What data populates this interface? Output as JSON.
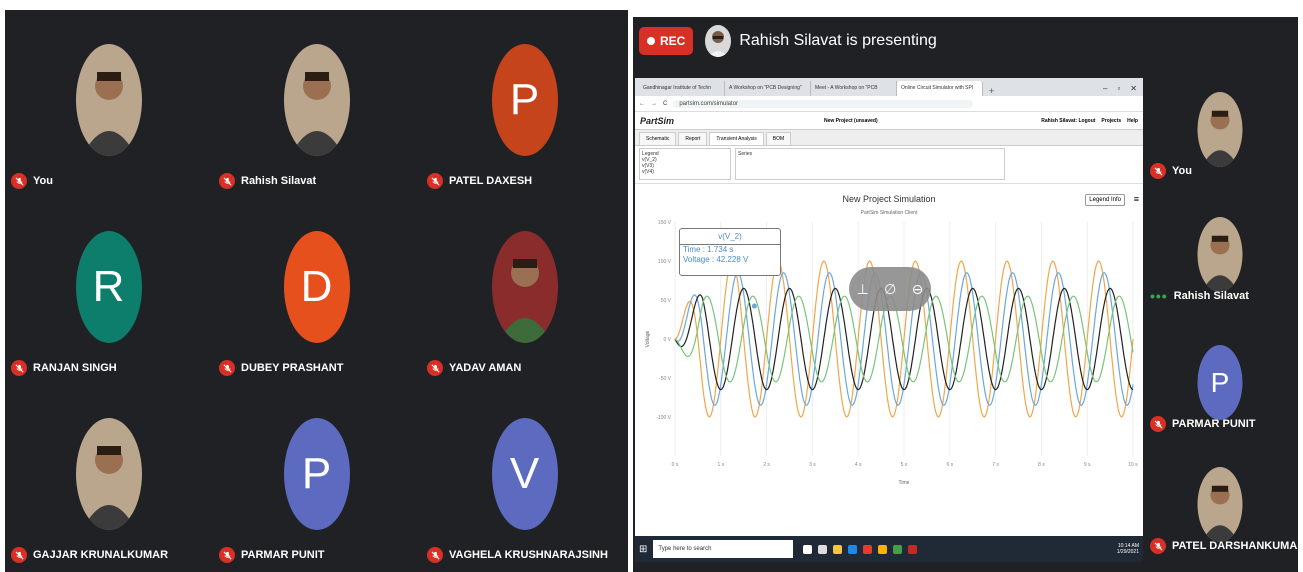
{
  "colors": {
    "meet_bg": "#202124",
    "mic_off": "#d93025",
    "rec": "#d93025",
    "avatar_orange_red": "#c5441b",
    "avatar_teal": "#0d7d6c",
    "avatar_orange": "#e6501c",
    "avatar_purple": "#5c6bc0",
    "series_blue": "#6ba6dd",
    "series_black": "#222222",
    "series_green": "#78c57a",
    "series_orange": "#f0a64a"
  },
  "participants": [
    {
      "name": "You",
      "avatar_type": "photo",
      "icon": "person-photo"
    },
    {
      "name": "Rahish Silavat",
      "avatar_type": "photo",
      "icon": "person-photo"
    },
    {
      "name": "PATEL DAXESH",
      "avatar_type": "letter",
      "letter": "P",
      "color": "#c5441b"
    },
    {
      "name": "RANJAN SINGH",
      "avatar_type": "letter",
      "letter": "R",
      "color": "#0d7d6c"
    },
    {
      "name": "DUBEY PRASHANT",
      "avatar_type": "letter",
      "letter": "D",
      "color": "#e6501c"
    },
    {
      "name": "YADAV AMAN",
      "avatar_type": "photo",
      "icon": "badge-photo"
    },
    {
      "name": "GAJJAR KRUNALKUMAR",
      "avatar_type": "photo",
      "icon": "person-photo"
    },
    {
      "name": "PARMAR PUNIT",
      "avatar_type": "letter",
      "letter": "P",
      "color": "#5c6bc0"
    },
    {
      "name": "VAGHELA KRUSHNARAJSINH",
      "avatar_type": "letter",
      "letter": "V",
      "color": "#5c6bc0"
    }
  ],
  "presentation": {
    "rec_label": "REC",
    "presenting_text": "Rahish Silavat is presenting"
  },
  "browser": {
    "tabs": [
      "Gandhinagar Institute of Techn",
      "A Workshop on \"PCB Designing\"",
      "Meet - A Workshop on \"PCB",
      "Online Circuit Simulator with SPI"
    ],
    "plus": "+",
    "url": "partsim.com/simulator"
  },
  "partsim": {
    "logo": "PartSim",
    "project": "New Project (unsaved)",
    "user": "Rahish Silavat: Logout",
    "projects": "Projects",
    "help": "Help",
    "tabs": [
      "Schematic",
      "Report",
      "Transient Analysis",
      "BOM"
    ],
    "legend_label": "Legend",
    "legend_items": [
      "v(V_2)",
      "v(V3)",
      "v(V4)"
    ],
    "series_label": "Series"
  },
  "chart_data": {
    "type": "line",
    "title": "New Project Simulation",
    "subtitle": "PartSim Simulation Client",
    "xlabel": "Time",
    "ylabel": "Voltage",
    "legend_info": "Legend Info",
    "y_ticks": [
      "150 V",
      "100 V",
      "50 V",
      "0 V",
      "-50 V",
      "-100 V"
    ],
    "x_ticks": [
      "0 s",
      "1 s",
      "2 s",
      "3 s",
      "4 s",
      "5 s",
      "6 s",
      "7 s",
      "8 s",
      "9 s",
      "10 s"
    ],
    "xlim": [
      0,
      10
    ],
    "ylim": [
      -150,
      150
    ],
    "series": [
      {
        "color": "#f0a64a",
        "amplitude": 100,
        "phase": 0.0
      },
      {
        "color": "#6ba6dd",
        "amplitude": 85,
        "phase": 0.12
      },
      {
        "color": "#222222",
        "amplitude": 65,
        "phase": 0.25
      },
      {
        "color": "#78c57a",
        "amplitude": 55,
        "phase": 0.45
      }
    ],
    "period": 1.0,
    "tooltip": {
      "series": "v(V_2)",
      "time": "Time   : 1.734 s",
      "voltage": "Voltage : 42.228 V"
    }
  },
  "taskbar": {
    "search_placeholder": "Type here to search",
    "time": "10:14 AM",
    "date": "1/29/2021"
  },
  "strip": [
    {
      "name": "You",
      "avatar_type": "photo",
      "speaking": false
    },
    {
      "name": "Rahish Silavat",
      "avatar_type": "photo",
      "speaking": true
    },
    {
      "name": "PARMAR PUNIT",
      "avatar_type": "letter",
      "letter": "P",
      "color": "#5c6bc0",
      "speaking": false
    },
    {
      "name": "PATEL DARSHANKUMAR",
      "avatar_type": "photo",
      "speaking": false
    }
  ]
}
